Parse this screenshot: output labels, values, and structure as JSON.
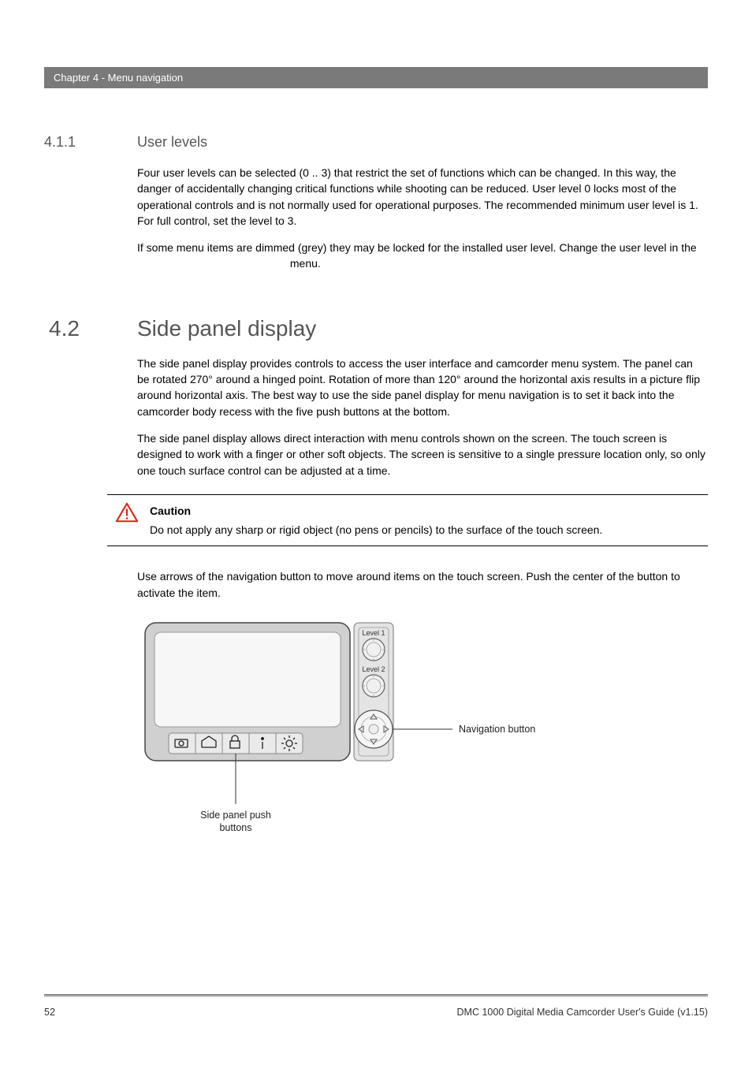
{
  "chapter_bar": "Chapter 4  - Menu navigation",
  "sec_411_num": "4.1.1",
  "sec_411_title": "User levels",
  "sec_411_p1": "Four user levels can be selected (0 .. 3) that restrict the set of functions which can be changed. In this way, the danger of accidentally changing critical functions while shooting can be reduced. User level 0 locks most of the operational controls and is not normally used for operational purposes. The recommended minimum user level is 1. For full control, set the level to 3.",
  "sec_411_p2a": "If some menu items are dimmed (grey) they may be locked for the installed user level. Change the user level in the ",
  "sec_411_p2b": " menu.",
  "sec_42_num": "4.2",
  "sec_42_title": "Side panel display",
  "sec_42_p1": "The side panel display provides controls to access the user interface and camcorder menu system. The panel can be rotated 270° around a hinged point. Rotation of more than 120° around the horizontal axis results in a picture flip around horizontal axis. The best way to use the side panel display for menu navigation is to set it back into the camcorder body recess with the five push buttons at the bottom.",
  "sec_42_p2": "The side panel display allows direct interaction with menu controls shown on the screen. The touch screen is designed to work with a finger or other soft objects. The screen is sensitive to a single pressure location only, so only one touch surface control can be adjusted at a time.",
  "caution_label": "Caution",
  "caution_text": "Do not apply any sharp or rigid object (no pens or pencils) to the surface of the touch screen.",
  "sec_42_p3": "Use arrows of the navigation button to move around items on the touch screen. Push the center of the button to activate the item.",
  "figure": {
    "level1": "Level 1",
    "level2": "Level 2",
    "nav_label": "Navigation button",
    "push_label_1": "Side panel push",
    "push_label_2": "buttons"
  },
  "footer_page": "52",
  "footer_doc": "DMC 1000 Digital Media Camcorder User's Guide (v1.15)"
}
